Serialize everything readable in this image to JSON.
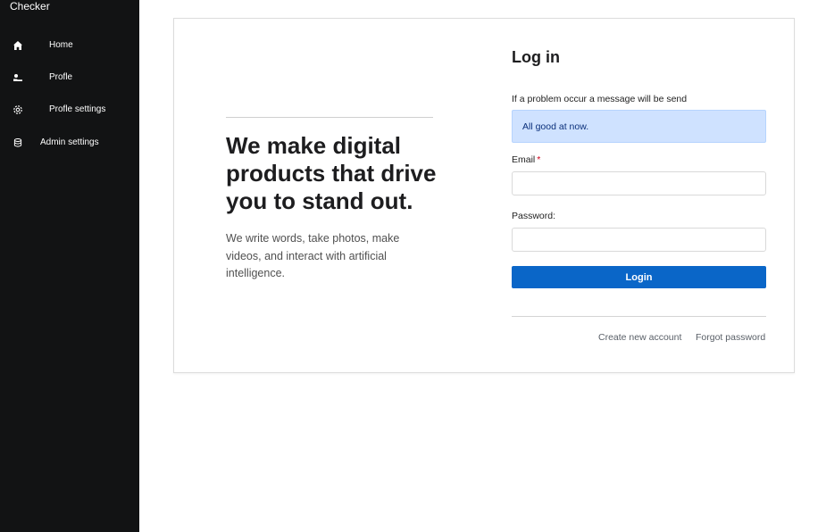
{
  "sidebar": {
    "brand": "Checker",
    "items": [
      {
        "label": "Home",
        "icon": "home-icon"
      },
      {
        "label": "Profle",
        "icon": "user-icon"
      },
      {
        "label": "Profle settings",
        "icon": "gear-icon"
      },
      {
        "label": "Admin settings",
        "icon": "database-icon"
      }
    ],
    "background_color": "#121314"
  },
  "hero": {
    "title": "We make digital products that drive you to stand out.",
    "text": "We write words, take photos, make videos, and interact with artificial intelligence."
  },
  "login": {
    "title": "Log in",
    "message_label": "If a problem occur a message will be send",
    "message": "All good at now.",
    "email_label": "Email",
    "required_mark": "*",
    "email_value": "",
    "password_label": "Password:",
    "password_value": "",
    "submit_label": "Login",
    "create_account_link": "Create new account",
    "forgot_password_link": "Forgot password",
    "button_color": "#0a66c8",
    "message_bg_color": "#cfe2ff"
  }
}
